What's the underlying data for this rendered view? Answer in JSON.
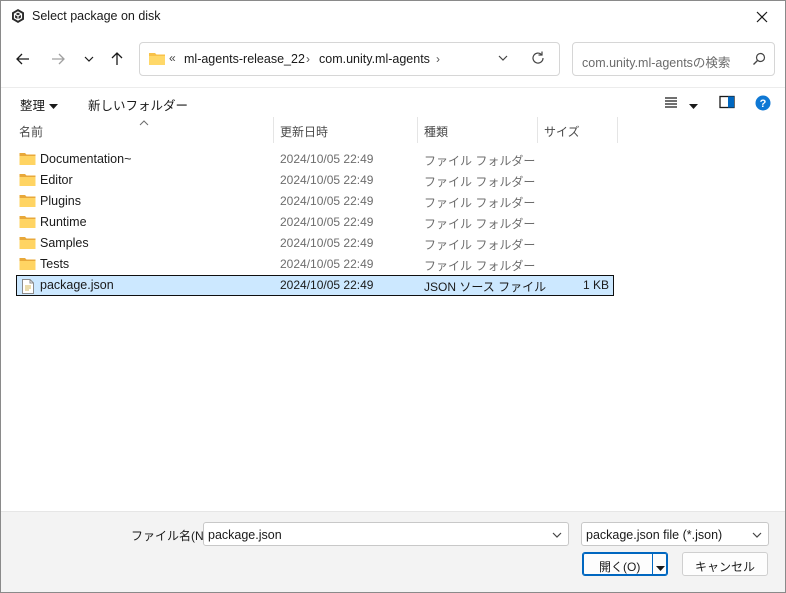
{
  "window": {
    "title": "Select package on disk"
  },
  "address": {
    "overflow": "«",
    "crumbs": [
      "ml-agents-release_22",
      "com.unity.ml-agents"
    ]
  },
  "search": {
    "placeholder": "com.unity.ml-agentsの検索"
  },
  "toolbar": {
    "organize_label": "整理",
    "new_folder_label": "新しいフォルダー"
  },
  "columns": {
    "name": "名前",
    "date": "更新日時",
    "type": "種類",
    "size": "サイズ"
  },
  "files": [
    {
      "name": "Documentation~",
      "date": "2024/10/05 22:49",
      "type": "ファイル フォルダー",
      "size": "",
      "icon": "folder-icon",
      "selected": false
    },
    {
      "name": "Editor",
      "date": "2024/10/05 22:49",
      "type": "ファイル フォルダー",
      "size": "",
      "icon": "folder-icon",
      "selected": false
    },
    {
      "name": "Plugins",
      "date": "2024/10/05 22:49",
      "type": "ファイル フォルダー",
      "size": "",
      "icon": "folder-icon",
      "selected": false
    },
    {
      "name": "Runtime",
      "date": "2024/10/05 22:49",
      "type": "ファイル フォルダー",
      "size": "",
      "icon": "folder-icon",
      "selected": false
    },
    {
      "name": "Samples",
      "date": "2024/10/05 22:49",
      "type": "ファイル フォルダー",
      "size": "",
      "icon": "folder-icon",
      "selected": false
    },
    {
      "name": "Tests",
      "date": "2024/10/05 22:49",
      "type": "ファイル フォルダー",
      "size": "",
      "icon": "folder-icon",
      "selected": false
    },
    {
      "name": "package.json",
      "date": "2024/10/05 22:49",
      "type": "JSON ソース ファイル",
      "size": "1 KB",
      "icon": "json-file-icon",
      "selected": true
    }
  ],
  "footer": {
    "filename_label": "ファイル名(N):",
    "filename_value": "package.json",
    "filetype_value": "package.json file (*.json)",
    "open_label": "開く(O)",
    "cancel_label": "キャンセル"
  },
  "colors": {
    "accent": "#0067c0",
    "selection": "#cce8ff",
    "folder": "#f8c24a",
    "help": "#0f78d4"
  }
}
